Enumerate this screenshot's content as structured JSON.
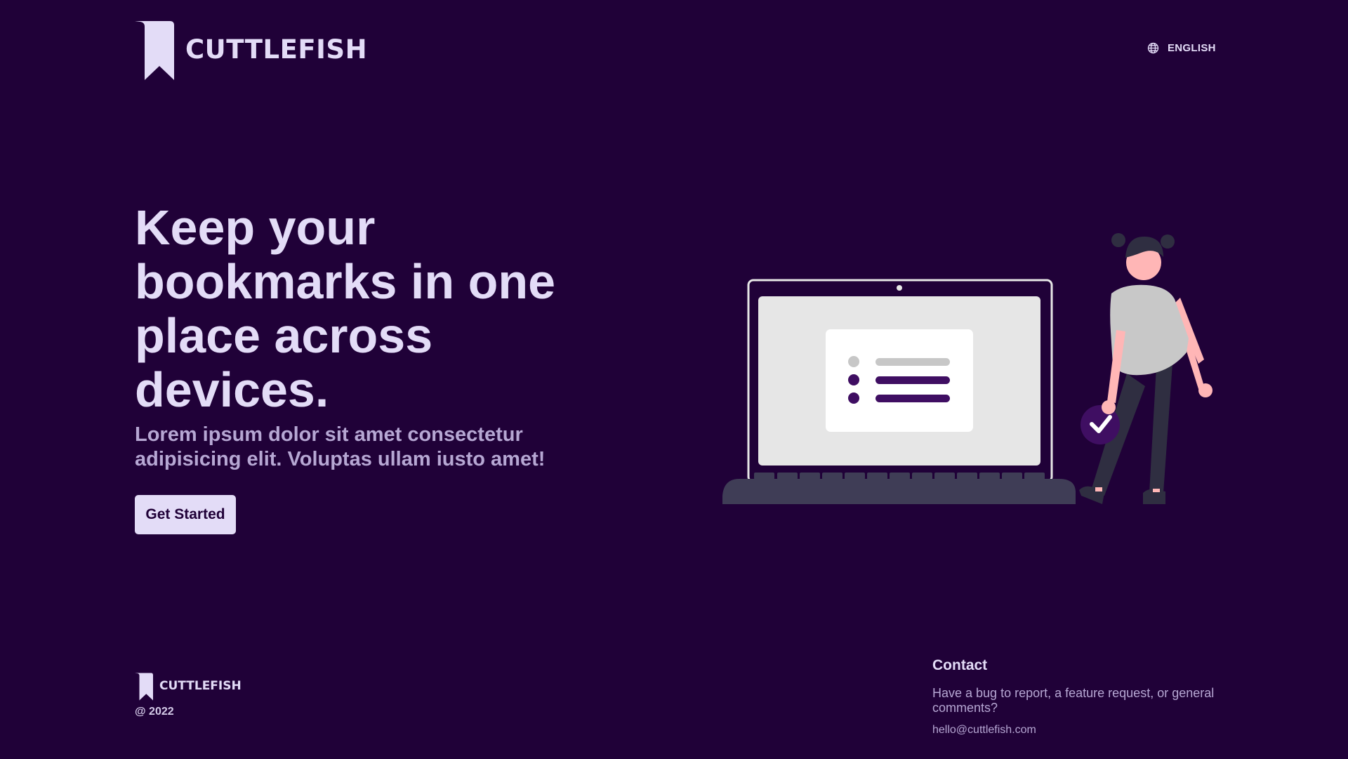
{
  "header": {
    "brand_name": "CUTTLEFISH",
    "language_label": "ENGLISH"
  },
  "hero": {
    "title": "Keep your bookmarks in one place across devices.",
    "subtitle": "Lorem ipsum dolor sit amet consectetur adipisicing elit. Voluptas ullam iusto amet!",
    "cta_label": "Get Started"
  },
  "footer": {
    "brand_name": "CUTTLEFISH",
    "copyright": "@ 2022",
    "contact_title": "Contact",
    "contact_text": "Have a bug to report, a feature request, or general comments?",
    "contact_email": "hello@cuttlefish.com"
  },
  "icons": {
    "logo": "bookmark-icon",
    "language": "globe-icon"
  },
  "colors": {
    "background": "#200138",
    "primary_text": "#e3dcf7",
    "secondary_text": "#b6a7d3",
    "accent": "#3f0e62"
  }
}
